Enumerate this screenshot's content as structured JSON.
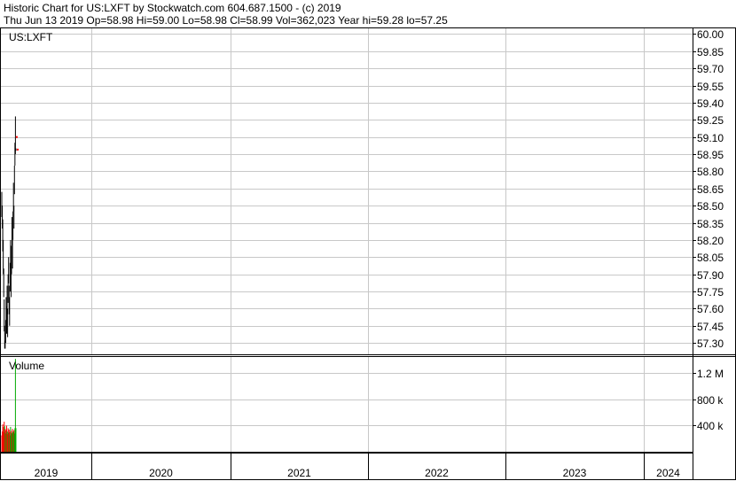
{
  "header": {
    "line1": "Historic Chart for US:LXFT by Stockwatch.com 604.687.1500 - (c) 2019",
    "line2": "Thu Jun 13 2019   Op=58.98   Hi=59.00   Lo=58.98   Cl=58.99   Vol=362,023   Year hi=59.28   lo=57.25"
  },
  "colors": {
    "price": "#000000",
    "down": "#ff0000",
    "up": "#00aa00",
    "grid": "#c8c8c8"
  },
  "chart_data": [
    {
      "type": "line",
      "panel": "price",
      "title": "US:LXFT",
      "y_ticks": [
        "60.00",
        "59.85",
        "59.70",
        "59.55",
        "59.40",
        "59.25",
        "59.10",
        "58.95",
        "58.80",
        "58.65",
        "58.50",
        "58.35",
        "58.20",
        "58.05",
        "57.90",
        "57.75",
        "57.60",
        "57.45",
        "57.30"
      ],
      "ylim": [
        57.2,
        60.05
      ],
      "x_ticks": [
        "2019",
        "2020",
        "2021",
        "2022",
        "2023",
        "2024"
      ],
      "series": [
        {
          "values": [
            58.55,
            58.45,
            58.3,
            58.1,
            57.85,
            57.55,
            57.35,
            57.25,
            57.4,
            57.6,
            57.5,
            57.7,
            57.45,
            57.8,
            57.95,
            57.7,
            57.55,
            57.9,
            58.1,
            57.85,
            58.05,
            58.3,
            58.1,
            58.35,
            58.6,
            58.4,
            58.75,
            58.95,
            59.1,
            58.99
          ],
          "high": [
            58.62,
            58.5,
            58.38,
            58.2,
            57.95,
            57.68,
            57.45,
            57.32,
            57.5,
            57.7,
            57.62,
            57.8,
            57.6,
            57.9,
            58.05,
            57.8,
            57.7,
            58.0,
            58.2,
            57.95,
            58.15,
            58.4,
            58.2,
            58.45,
            58.7,
            58.5,
            58.85,
            59.05,
            59.28,
            59.0
          ],
          "low": [
            58.4,
            58.3,
            58.1,
            57.9,
            57.7,
            57.4,
            57.25,
            57.25,
            57.3,
            57.45,
            57.38,
            57.55,
            57.35,
            57.65,
            57.82,
            57.55,
            57.45,
            57.75,
            57.95,
            57.7,
            57.9,
            58.15,
            57.95,
            58.2,
            58.45,
            58.3,
            58.6,
            58.85,
            58.95,
            58.98
          ]
        }
      ]
    },
    {
      "type": "bar",
      "panel": "volume",
      "title": "Volume",
      "y_ticks": [
        "1.2 M",
        "800 k",
        "400 k"
      ],
      "y_tick_values": [
        1200000,
        800000,
        400000
      ],
      "ylim": [
        0,
        1450000
      ],
      "values": [
        250000,
        310000,
        420000,
        380000,
        300000,
        460000,
        390000,
        350000,
        280000,
        330000,
        400000,
        310000,
        270000,
        360000,
        290000,
        340000,
        300000,
        250000,
        380000,
        320000,
        290000,
        270000,
        350000,
        310000,
        300000,
        330000,
        280000,
        360000,
        1420000,
        362023
      ],
      "directions": [
        "d",
        "d",
        "d",
        "d",
        "d",
        "d",
        "u",
        "d",
        "u",
        "d",
        "d",
        "u",
        "d",
        "d",
        "u",
        "d",
        "d",
        "u",
        "u",
        "d",
        "u",
        "u",
        "d",
        "u",
        "u",
        "d",
        "u",
        "u",
        "u",
        "u"
      ]
    }
  ]
}
